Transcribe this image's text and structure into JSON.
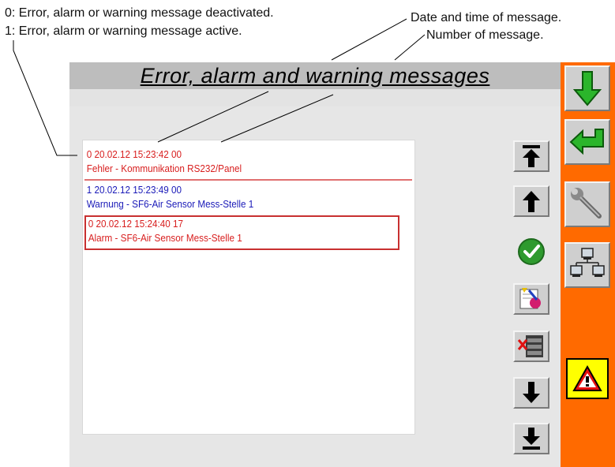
{
  "annotations": {
    "legend_0": "0: Error, alarm or warning message deactivated.",
    "legend_1": "1: Error, alarm or warning message active.",
    "date_time": "Date and time of message.",
    "number": "Number of message."
  },
  "screen": {
    "title": "Error, alarm and warning messages"
  },
  "messages": [
    {
      "header": "0 20.02.12 15:23:42 00",
      "text": "Fehler - Kommunikation RS232/Panel",
      "status": "deactivated",
      "color": "#d81e1e"
    },
    {
      "header": "1 20.02.12 15:23:49 00",
      "text": "Warnung - SF6-Air Sensor Mess-Stelle 1",
      "status": "active",
      "color": "#1a1ab8"
    },
    {
      "header": "0 20.02.12 15:24:40 17",
      "text": "Alarm - SF6-Air Sensor Mess-Stelle 1",
      "status": "deactivated",
      "selected": true,
      "color": "#d81e1e"
    }
  ],
  "list_buttons": [
    {
      "icon": "scroll-top-icon"
    },
    {
      "icon": "scroll-up-icon"
    },
    {
      "icon": "acknowledge-check-icon"
    },
    {
      "icon": "edit-note-icon"
    },
    {
      "icon": "delete-archive-icon"
    },
    {
      "icon": "scroll-down-icon"
    },
    {
      "icon": "scroll-bottom-icon"
    }
  ],
  "sidebar_buttons": [
    {
      "icon": "green-down-arrow-icon"
    },
    {
      "icon": "green-return-arrow-icon"
    },
    {
      "icon": "wrench-icon"
    },
    {
      "icon": "network-icon"
    },
    {
      "icon": "warning-triangle-icon"
    }
  ],
  "colors": {
    "sidebar": "#ff6a00",
    "error_text": "#d81e1e",
    "warning_text": "#1a1ab8",
    "warning_button": "#ffff00"
  }
}
